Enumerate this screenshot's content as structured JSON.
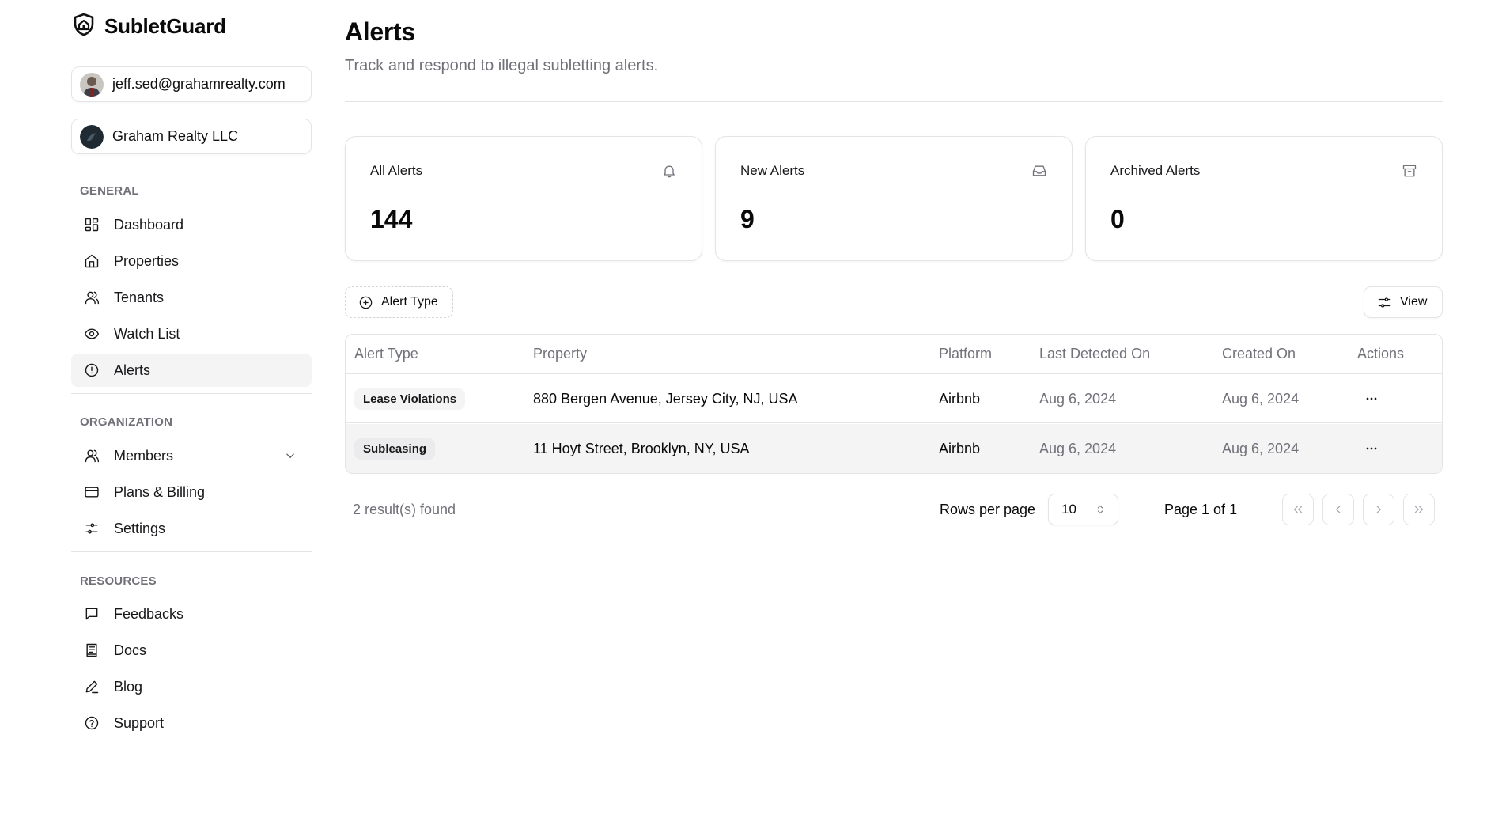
{
  "brand": {
    "name": "SubletGuard",
    "icon": "shield-home-icon"
  },
  "account": {
    "email": "jeff.sed@grahamrealty.com"
  },
  "organization": {
    "name": "Graham Realty LLC"
  },
  "sidebar": {
    "general_label": "GENERAL",
    "general": [
      {
        "label": "Dashboard",
        "icon": "dashboard-icon"
      },
      {
        "label": "Properties",
        "icon": "home-icon"
      },
      {
        "label": "Tenants",
        "icon": "user-icon"
      },
      {
        "label": "Watch List",
        "icon": "eye-icon"
      },
      {
        "label": "Alerts",
        "icon": "alert-circle-icon",
        "active": true
      }
    ],
    "organization_label": "ORGANIZATION",
    "organization": [
      {
        "label": "Members",
        "icon": "user-icon"
      },
      {
        "label": "Plans & Billing",
        "icon": "credit-card-icon"
      },
      {
        "label": "Settings",
        "icon": "settings-sliders-icon"
      }
    ],
    "resources_label": "RESOURCES",
    "resources": [
      {
        "label": "Feedbacks",
        "icon": "message-square-icon"
      },
      {
        "label": "Docs",
        "icon": "book-icon"
      },
      {
        "label": "Blog",
        "icon": "pen-icon"
      },
      {
        "label": "Support",
        "icon": "help-circle-icon"
      }
    ]
  },
  "page": {
    "title": "Alerts",
    "subtitle": "Track and respond to illegal subletting alerts."
  },
  "stats": [
    {
      "label": "All Alerts",
      "value": "144",
      "icon": "bell-icon"
    },
    {
      "label": "New Alerts",
      "value": "9",
      "icon": "inbox-icon"
    },
    {
      "label": "Archived Alerts",
      "value": "0",
      "icon": "archive-icon"
    }
  ],
  "toolbar": {
    "filter_label": "Alert Type",
    "view_label": "View"
  },
  "table": {
    "columns": [
      "Alert Type",
      "Property",
      "Platform",
      "Last Detected On",
      "Created On",
      "Actions"
    ],
    "rows": [
      {
        "alert_type": "Lease Violations",
        "property": "880 Bergen Avenue, Jersey City, NJ, USA",
        "platform": "Airbnb",
        "last_detected": "Aug 6, 2024",
        "created": "Aug 6, 2024"
      },
      {
        "alert_type": "Subleasing",
        "property": "11 Hoyt Street, Brooklyn, NY, USA",
        "platform": "Airbnb",
        "last_detected": "Aug 6, 2024",
        "created": "Aug 6, 2024"
      }
    ]
  },
  "pagination": {
    "results": "2 result(s) found",
    "rows_per_page_label": "Rows per page",
    "rows_per_page": "10",
    "page_info": "Page 1 of 1"
  },
  "colors": {
    "accent_bg": "#f4f4f5",
    "border": "#e4e4e7",
    "muted_text": "#71717a",
    "text": "#0a0a0a"
  }
}
